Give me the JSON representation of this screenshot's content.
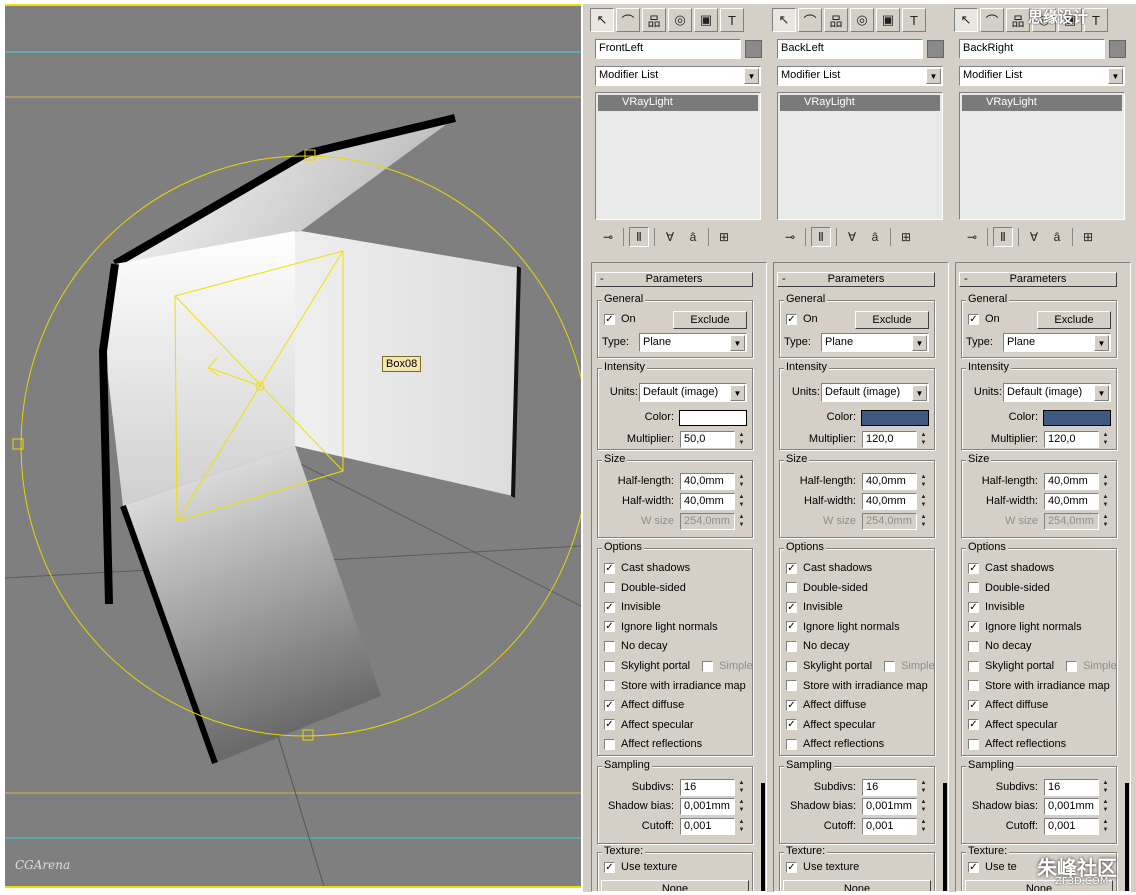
{
  "viewport": {
    "object_label": "Box08",
    "watermark": "CGArena"
  },
  "panels": [
    {
      "name": "FrontLeft",
      "modifier_list": "Modifier List",
      "stack_item": "VRayLight",
      "rollout_title": "Parameters",
      "general": {
        "title": "General",
        "on_label": "On",
        "on": true,
        "exclude_label": "Exclude",
        "type_label": "Type:",
        "type_value": "Plane"
      },
      "intensity": {
        "title": "Intensity",
        "units_label": "Units:",
        "units_value": "Default (image)",
        "color_label": "Color:",
        "color": "#ffffff",
        "multiplier_label": "Multiplier:",
        "multiplier": "50,0"
      },
      "size": {
        "title": "Size",
        "half_length_label": "Half-length:",
        "half_length": "40,0mm",
        "half_width_label": "Half-width:",
        "half_width": "40,0mm",
        "w_size_label": "W size",
        "w_size": "254,0mm"
      },
      "options": {
        "title": "Options",
        "items": [
          {
            "label": "Cast shadows",
            "checked": true
          },
          {
            "label": "Double-sided",
            "checked": false
          },
          {
            "label": "Invisible",
            "checked": true
          },
          {
            "label": "Ignore light normals",
            "checked": true
          },
          {
            "label": "No decay",
            "checked": false
          },
          {
            "label": "Skylight portal",
            "checked": false
          },
          {
            "label": "Store with irradiance map",
            "checked": false
          },
          {
            "label": "Affect diffuse",
            "checked": true
          },
          {
            "label": "Affect specular",
            "checked": true
          },
          {
            "label": "Affect reflections",
            "checked": false
          }
        ],
        "simple_label": "Simple"
      },
      "sampling": {
        "title": "Sampling",
        "subdivs_label": "Subdivs:",
        "subdivs": "16",
        "shadow_bias_label": "Shadow bias:",
        "shadow_bias": "0,001mm",
        "cutoff_label": "Cutoff:",
        "cutoff": "0,001"
      },
      "texture": {
        "title": "Texture:",
        "use_texture_label": "Use texture",
        "use_texture": true,
        "map_button": "None"
      }
    },
    {
      "name": "BackLeft",
      "modifier_list": "Modifier List",
      "stack_item": "VRayLight",
      "rollout_title": "Parameters",
      "general": {
        "title": "General",
        "on_label": "On",
        "on": true,
        "exclude_label": "Exclude",
        "type_label": "Type:",
        "type_value": "Plane"
      },
      "intensity": {
        "title": "Intensity",
        "units_label": "Units:",
        "units_value": "Default (image)",
        "color_label": "Color:",
        "color": "#3f5a80",
        "multiplier_label": "Multiplier:",
        "multiplier": "120,0"
      },
      "size": {
        "title": "Size",
        "half_length_label": "Half-length:",
        "half_length": "40,0mm",
        "half_width_label": "Half-width:",
        "half_width": "40,0mm",
        "w_size_label": "W size",
        "w_size": "254,0mm"
      },
      "options": {
        "title": "Options",
        "items": [
          {
            "label": "Cast shadows",
            "checked": true
          },
          {
            "label": "Double-sided",
            "checked": false
          },
          {
            "label": "Invisible",
            "checked": true
          },
          {
            "label": "Ignore light normals",
            "checked": true
          },
          {
            "label": "No decay",
            "checked": false
          },
          {
            "label": "Skylight portal",
            "checked": false
          },
          {
            "label": "Store with irradiance map",
            "checked": false
          },
          {
            "label": "Affect diffuse",
            "checked": true
          },
          {
            "label": "Affect specular",
            "checked": true
          },
          {
            "label": "Affect reflections",
            "checked": false
          }
        ],
        "simple_label": "Simple"
      },
      "sampling": {
        "title": "Sampling",
        "subdivs_label": "Subdivs:",
        "subdivs": "16",
        "shadow_bias_label": "Shadow bias:",
        "shadow_bias": "0,001mm",
        "cutoff_label": "Cutoff:",
        "cutoff": "0,001"
      },
      "texture": {
        "title": "Texture:",
        "use_texture_label": "Use texture",
        "use_texture": true,
        "map_button": "None"
      }
    },
    {
      "name": "BackRight",
      "modifier_list": "Modifier List",
      "stack_item": "VRayLight",
      "rollout_title": "Parameters",
      "general": {
        "title": "General",
        "on_label": "On",
        "on": true,
        "exclude_label": "Exclude",
        "type_label": "Type:",
        "type_value": "Plane"
      },
      "intensity": {
        "title": "Intensity",
        "units_label": "Units:",
        "units_value": "Default (image)",
        "color_label": "Color:",
        "color": "#3f5a80",
        "multiplier_label": "Multiplier:",
        "multiplier": "120,0"
      },
      "size": {
        "title": "Size",
        "half_length_label": "Half-length:",
        "half_length": "40,0mm",
        "half_width_label": "Half-width:",
        "half_width": "40,0mm",
        "w_size_label": "W size",
        "w_size": "254,0mm"
      },
      "options": {
        "title": "Options",
        "items": [
          {
            "label": "Cast shadows",
            "checked": true
          },
          {
            "label": "Double-sided",
            "checked": false
          },
          {
            "label": "Invisible",
            "checked": true
          },
          {
            "label": "Ignore light normals",
            "checked": true
          },
          {
            "label": "No decay",
            "checked": false
          },
          {
            "label": "Skylight portal",
            "checked": false
          },
          {
            "label": "Store with irradiance map",
            "checked": false
          },
          {
            "label": "Affect diffuse",
            "checked": true
          },
          {
            "label": "Affect specular",
            "checked": true
          },
          {
            "label": "Affect reflections",
            "checked": false
          }
        ],
        "simple_label": "Simple"
      },
      "sampling": {
        "title": "Sampling",
        "subdivs_label": "Subdivs:",
        "subdivs": "16",
        "shadow_bias_label": "Shadow bias:",
        "shadow_bias": "0,001mm",
        "cutoff_label": "Cutoff:",
        "cutoff": "0,001"
      },
      "texture": {
        "title": "Texture:",
        "use_texture_label": "Use te",
        "use_texture": true,
        "map_button": "None"
      }
    }
  ],
  "icons": {
    "toolbar": [
      "select-arrow-icon",
      "curve-icon",
      "hierarchy-icon",
      "motion-icon",
      "display-icon",
      "utilities-hammer-icon"
    ],
    "stack_tools": [
      "pin-icon",
      "show-end-result-icon",
      "make-unique-icon",
      "remove-modifier-icon",
      "configure-icon"
    ]
  },
  "watermarks": {
    "top": "思缘设计",
    "bottom_main": "朱峰社区",
    "bottom_url": "ZF3D.COM"
  }
}
